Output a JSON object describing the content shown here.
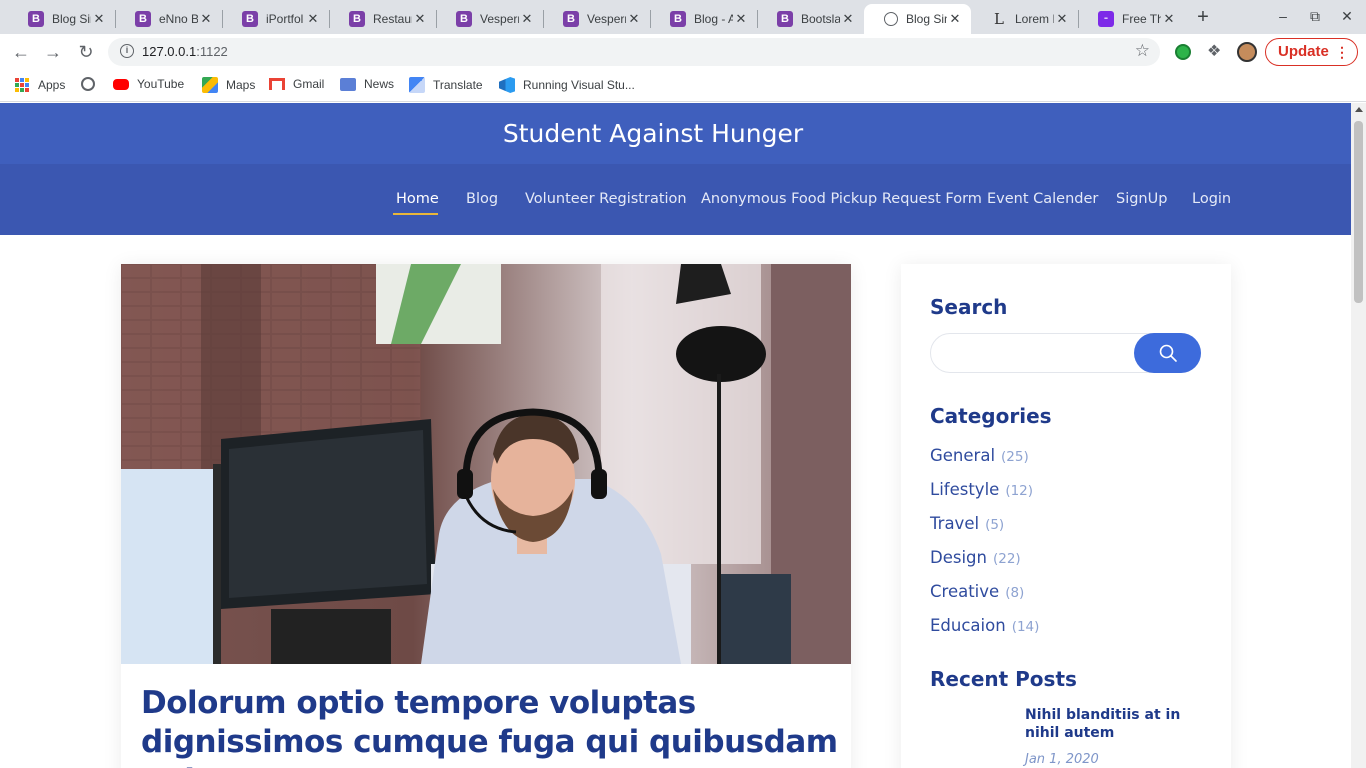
{
  "browser": {
    "tabs": [
      {
        "title": "Blog Sin",
        "icon": "bootstrap-icon",
        "color": "#7b3fa8"
      },
      {
        "title": "eNno B",
        "icon": "bootstrap-icon",
        "color": "#7b3fa8"
      },
      {
        "title": "iPortfol",
        "icon": "bootstrap-icon",
        "color": "#7b3fa8"
      },
      {
        "title": "Restaur",
        "icon": "bootstrap-icon",
        "color": "#7b3fa8"
      },
      {
        "title": "Vesperr",
        "icon": "bootstrap-icon",
        "color": "#7b3fa8"
      },
      {
        "title": "Vesperr",
        "icon": "bootstrap-icon",
        "color": "#7b3fa8"
      },
      {
        "title": "Blog - A",
        "icon": "bootstrap-icon",
        "color": "#7b3fa8"
      },
      {
        "title": "Bootsla",
        "icon": "bootstrap-icon",
        "color": "#7b3fa8"
      },
      {
        "title": "Blog Sin",
        "icon": "globe-icon",
        "color": "#5f6368",
        "active": true
      },
      {
        "title": "Lorem I",
        "icon": "lorem-icon",
        "color": "#333333"
      },
      {
        "title": "Free Th",
        "icon": "colorlib-icon",
        "color": "#7d2ae8"
      }
    ],
    "new_tab_label": "+",
    "url_host": "127.0.0.1",
    "url_port": ":1122",
    "update_label": "Update",
    "bookmarks": [
      {
        "label": "Apps",
        "icon": "apps-grid-icon"
      },
      {
        "label": "",
        "icon": "globe-icon"
      },
      {
        "label": "YouTube",
        "icon": "youtube-icon"
      },
      {
        "label": "Maps",
        "icon": "maps-icon"
      },
      {
        "label": "Gmail",
        "icon": "gmail-icon"
      },
      {
        "label": "News",
        "icon": "news-icon"
      },
      {
        "label": "Translate",
        "icon": "translate-icon"
      },
      {
        "label": "Running Visual Stu...",
        "icon": "vscode-icon"
      }
    ]
  },
  "site": {
    "title": "Student Against Hunger",
    "nav": [
      {
        "label": "Home",
        "active": true
      },
      {
        "label": "Blog"
      },
      {
        "label": "Volunteer Registration"
      },
      {
        "label": "Anonymous Food Pickup Request Form"
      },
      {
        "label": "Event Calender"
      },
      {
        "label": "SignUp"
      },
      {
        "label": "Login"
      }
    ],
    "colors": {
      "header": "#3f5fbd",
      "nav": "#3b57b1",
      "accent": "#e8b63a",
      "heading": "#1f3a8a",
      "button": "#3d6bdc"
    }
  },
  "post": {
    "title": "Dolorum optio tempore voluptas dignissimos cumque fuga qui quibusdam quia"
  },
  "sidebar": {
    "search_heading": "Search",
    "search_placeholder": "",
    "categories_heading": "Categories",
    "categories": [
      {
        "name": "General",
        "count": "(25)"
      },
      {
        "name": "Lifestyle",
        "count": "(12)"
      },
      {
        "name": "Travel",
        "count": "(5)"
      },
      {
        "name": "Design",
        "count": "(22)"
      },
      {
        "name": "Creative",
        "count": "(8)"
      },
      {
        "name": "Educaion",
        "count": "(14)"
      }
    ],
    "recent_heading": "Recent Posts",
    "recent_posts": [
      {
        "title": "Nihil blanditiis at in nihil autem",
        "date": "Jan 1, 2020"
      }
    ]
  }
}
